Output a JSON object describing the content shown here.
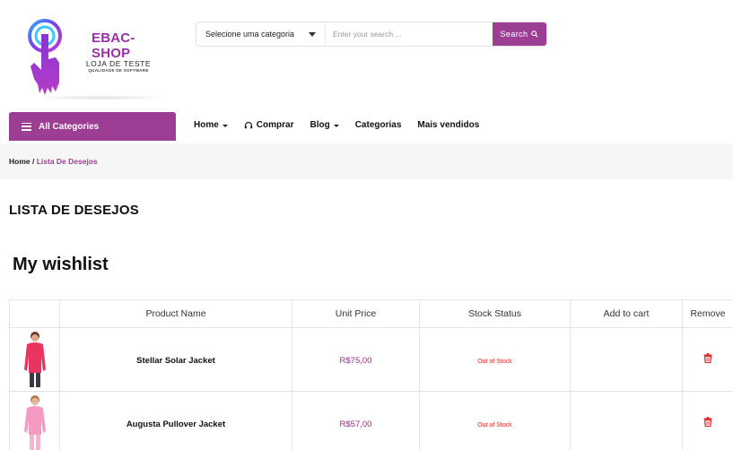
{
  "header": {
    "brand_name": "EBAC-SHOP",
    "brand_tagline": "LOJA DE TESTE",
    "brand_subtagline": "QUALIDADE DE SOFTWARE",
    "category_select": "Selecione uma categoria",
    "search_placeholder": "Enter your search ...",
    "search_button": "Search"
  },
  "nav": {
    "all_categories": "All Categories",
    "items": [
      {
        "label": "Home",
        "dropdown": true,
        "icon": null
      },
      {
        "label": "Comprar",
        "dropdown": false,
        "icon": "headset-icon"
      },
      {
        "label": "Blog",
        "dropdown": true,
        "icon": null
      },
      {
        "label": "Categorias",
        "dropdown": false,
        "icon": null
      },
      {
        "label": "Mais vendidos",
        "dropdown": false,
        "icon": null
      }
    ]
  },
  "breadcrumb": {
    "home": "Home",
    "separator": " / ",
    "current": "Lista De Desejos"
  },
  "page_title": "LISTA DE DESEJOS",
  "wishlist": {
    "title": "My wishlist",
    "columns": [
      "",
      "Product Name",
      "Unit Price",
      "Stock Status",
      "Add to cart",
      "Remove"
    ],
    "rows": [
      {
        "name": "Stellar Solar Jacket",
        "price": "R$75,00",
        "stock": "Out of Stock",
        "image": "pink-jacket-model"
      },
      {
        "name": "Augusta Pullover Jacket",
        "price": "R$57,00",
        "stock": "Out of Stock",
        "image": "light-pink-pullover-model"
      }
    ]
  },
  "colors": {
    "brand_purple": "#9b3e94",
    "price_purple": "#8e2f8a",
    "stock_red": "#e02424",
    "breadcrumb_bg": "#f6f6f6"
  }
}
